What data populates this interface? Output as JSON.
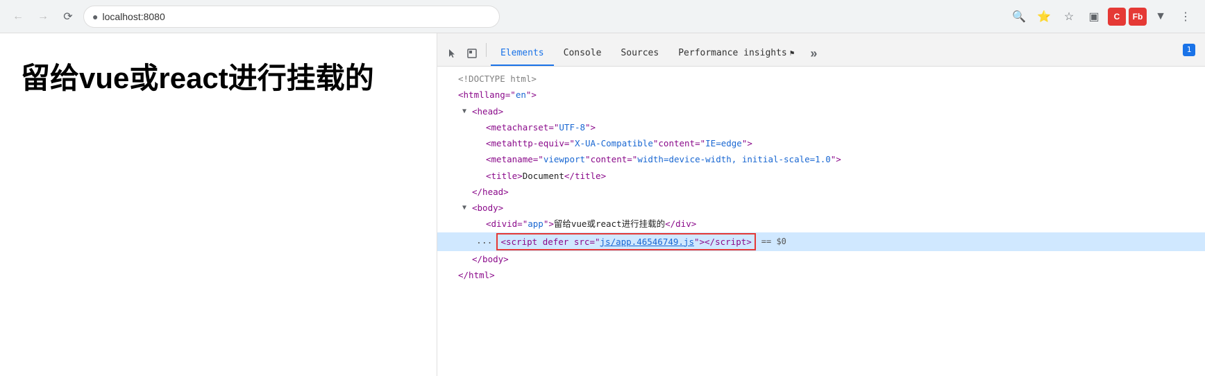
{
  "browser": {
    "url": "localhost:8080",
    "back_disabled": true,
    "forward_disabled": true
  },
  "page": {
    "heading": "留给vue或react进行挂载的"
  },
  "devtools": {
    "tabs": [
      {
        "id": "elements",
        "label": "Elements",
        "active": true
      },
      {
        "id": "console",
        "label": "Console",
        "active": false
      },
      {
        "id": "sources",
        "label": "Sources",
        "active": false
      },
      {
        "id": "performance",
        "label": "Performance insights",
        "active": false
      }
    ],
    "notification_count": "1",
    "dom": {
      "lines": [
        {
          "indent": 0,
          "type": "comment",
          "text": "<!DOCTYPE html>"
        },
        {
          "indent": 0,
          "type": "tag",
          "text": "<html lang=\"en\">"
        },
        {
          "indent": 1,
          "type": "tag-collapsed",
          "text": "▼<head>"
        },
        {
          "indent": 2,
          "type": "tag",
          "text": "<meta charset=\"UTF-8\">"
        },
        {
          "indent": 2,
          "type": "tag",
          "text": "<meta http-equiv=\"X-UA-Compatible\" content=\"IE=edge\">"
        },
        {
          "indent": 2,
          "type": "tag",
          "text": "<meta name=\"viewport\" content=\"width=device-width, initial-scale=1.0\">"
        },
        {
          "indent": 2,
          "type": "tag",
          "text": "<title>Document</title>"
        },
        {
          "indent": 1,
          "type": "tag",
          "text": "</head>"
        },
        {
          "indent": 1,
          "type": "tag-collapsed",
          "text": "▼<body>"
        },
        {
          "indent": 2,
          "type": "tag",
          "text": "<div id=\"app\">留给vue或react进行挂载的</div>"
        },
        {
          "indent": 2,
          "type": "script",
          "text": "<script defer src=\"js/app.46546749.js\"></script>",
          "highlight": true,
          "equals": "== $0"
        },
        {
          "indent": 1,
          "type": "tag",
          "text": "</body>"
        },
        {
          "indent": 0,
          "type": "tag",
          "text": "</html>"
        }
      ]
    }
  }
}
